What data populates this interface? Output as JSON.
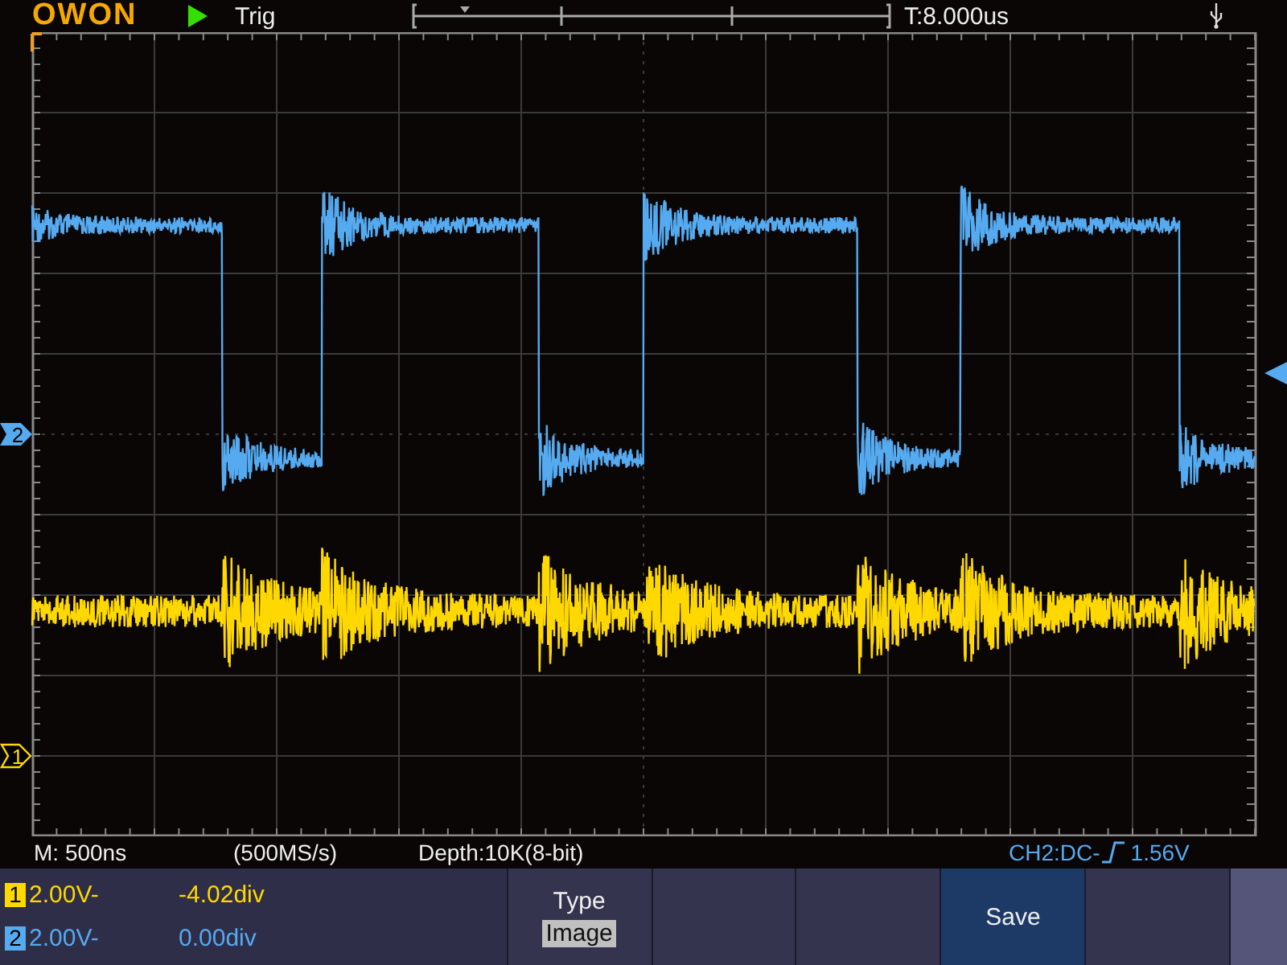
{
  "header": {
    "brand": "OWON",
    "run_state": "Trig",
    "trigger_position": "T:8.000us"
  },
  "status": {
    "timebase": "M: 500ns",
    "sample_rate": "(500MS/s)",
    "depth": "Depth:10K(8-bit)",
    "trigger_source": "CH2:DC-",
    "trigger_level": "1.56V"
  },
  "channel_markers": [
    {
      "label": "2",
      "kind": "filled",
      "color": "#55aaf0"
    },
    {
      "label": "1",
      "kind": "outline",
      "color": "#ffd800"
    }
  ],
  "channels": [
    {
      "number": "1",
      "scale": "2.00V-",
      "offset": "-4.02div",
      "color": "#ffd800"
    },
    {
      "number": "2",
      "scale": "2.00V-",
      "offset": "0.00div",
      "color": "#55aaf0"
    }
  ],
  "menu": [
    {
      "kind": "option",
      "label": "Type",
      "value": "Image",
      "selected": false
    },
    {
      "kind": "empty",
      "selected": false
    },
    {
      "kind": "empty",
      "selected": false
    },
    {
      "kind": "action",
      "label": "Save",
      "selected": true
    },
    {
      "kind": "empty",
      "selected": false
    }
  ]
}
